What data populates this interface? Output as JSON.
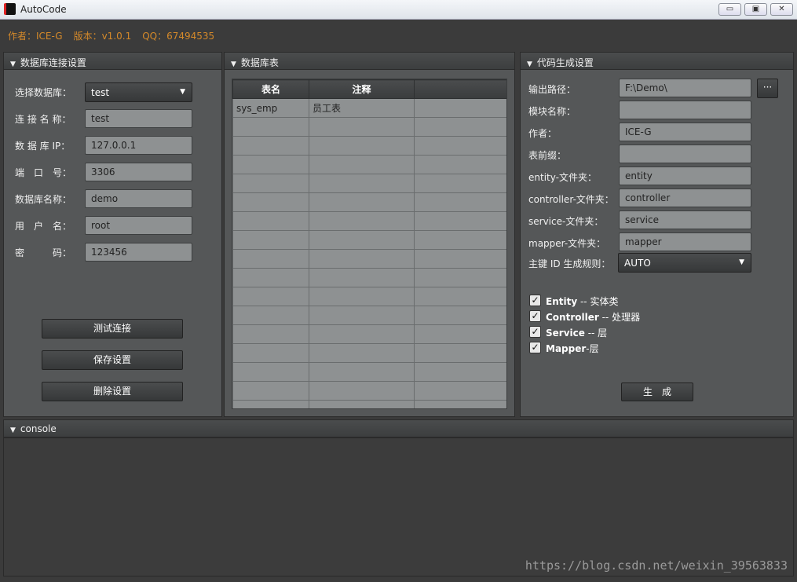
{
  "window": {
    "title": "AutoCode",
    "minimize": "▭",
    "restore": "▣",
    "close": "✕"
  },
  "info": {
    "author": "作者：ICE-G",
    "version": "版本：v1.0.1",
    "qq": "QQ：67494535"
  },
  "db_panel": {
    "title": "数据库连接设置",
    "select_label": "选择数据库：",
    "select_value": "test",
    "fields": [
      {
        "label": "连 接 名 称：",
        "value": "test"
      },
      {
        "label": "数 据 库 IP：",
        "value": "127.0.0.1"
      },
      {
        "label": "端　口　号：",
        "value": "3306"
      },
      {
        "label": "数据库名称：",
        "value": "demo"
      },
      {
        "label": "用　户　名：",
        "value": "root"
      },
      {
        "label": "密　　　码：",
        "value": "123456"
      }
    ],
    "buttons": [
      "测试连接",
      "保存设置",
      "删除设置"
    ]
  },
  "table_panel": {
    "title": "数据库表",
    "columns": [
      "表名",
      "注释",
      ""
    ],
    "rows": [
      [
        "sys_emp",
        "员工表",
        ""
      ]
    ]
  },
  "gen_panel": {
    "title": "代码生成设置",
    "fields": [
      {
        "label": "输出路径：",
        "value": "F:\\Demo\\"
      },
      {
        "label": "模块名称：",
        "value": ""
      },
      {
        "label": "作者：",
        "value": "ICE-G"
      },
      {
        "label": "表前缀：",
        "value": ""
      },
      {
        "label": "entity-文件夹：",
        "value": "entity"
      },
      {
        "label": "controller-文件夹：",
        "value": "controller"
      },
      {
        "label": "service-文件夹：",
        "value": "service"
      },
      {
        "label": "mapper-文件夹：",
        "value": "mapper"
      }
    ],
    "browse": "···",
    "pk_label": "主键 ID 生成规则：",
    "pk_value": "AUTO",
    "checks": [
      {
        "bold": "Entity",
        "rest": " -- 实体类",
        "checked": true
      },
      {
        "bold": "Controller",
        "rest": " -- 处理器",
        "checked": true
      },
      {
        "bold": "Service",
        "rest": " -- 层",
        "checked": true
      },
      {
        "bold": "Mapper",
        "rest": "-层",
        "checked": true
      }
    ],
    "generate": "生　成"
  },
  "console": {
    "title": "console"
  },
  "watermark": "https://blog.csdn.net/weixin_39563833"
}
